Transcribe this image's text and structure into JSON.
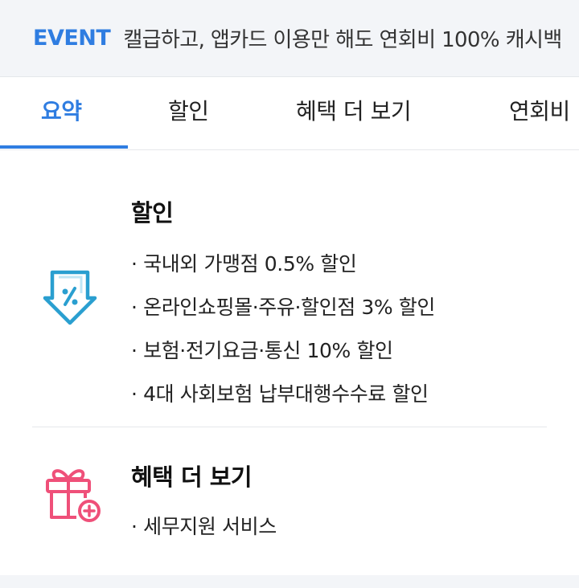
{
  "event": {
    "label": "EVENT",
    "text": "캘급하고, 앱카드 이용만 해도 연회비 100% 캐시백"
  },
  "tabs": [
    {
      "label": "요약",
      "active": true
    },
    {
      "label": "할인",
      "active": false
    },
    {
      "label": "혜택 더 보기",
      "active": false
    },
    {
      "label": "연회비",
      "active": false
    }
  ],
  "discount": {
    "title": "할인",
    "icon": "discount-tag-arrow-icon",
    "items": [
      "· 국내외 가맹점 0.5% 할인",
      "· 온라인쇼핑몰·주유·할인점 3% 할인",
      "· 보험·전기요금·통신 10% 할인",
      "· 4대 사회보험 납부대행수수료 할인"
    ]
  },
  "more_benefits": {
    "title": "혜택 더 보기",
    "icon": "gift-plus-icon",
    "items": [
      "· 세무지원 서비스"
    ]
  },
  "colors": {
    "accent": "#2f7de1",
    "discount_icon": "#2a9fd0",
    "gift_icon": "#ef5079"
  }
}
